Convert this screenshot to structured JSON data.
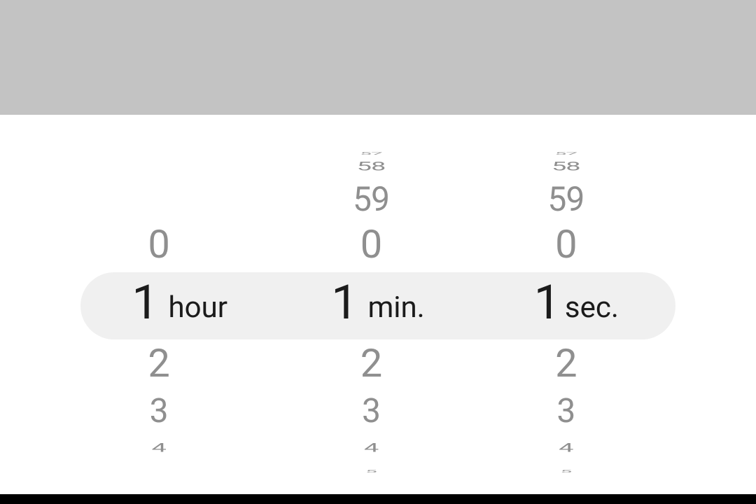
{
  "picker": {
    "hour": {
      "label": "hour",
      "selected": "1",
      "above": [
        "",
        "",
        "",
        "0"
      ],
      "below": [
        "2",
        "3",
        "4",
        ""
      ]
    },
    "minute": {
      "label": "min.",
      "selected": "1",
      "above": [
        "57",
        "58",
        "59",
        "0"
      ],
      "below": [
        "2",
        "3",
        "4",
        "5"
      ]
    },
    "second": {
      "label": "sec.",
      "selected": "1",
      "above": [
        "57",
        "58",
        "59",
        "0"
      ],
      "below": [
        "2",
        "3",
        "4",
        "5"
      ]
    }
  }
}
